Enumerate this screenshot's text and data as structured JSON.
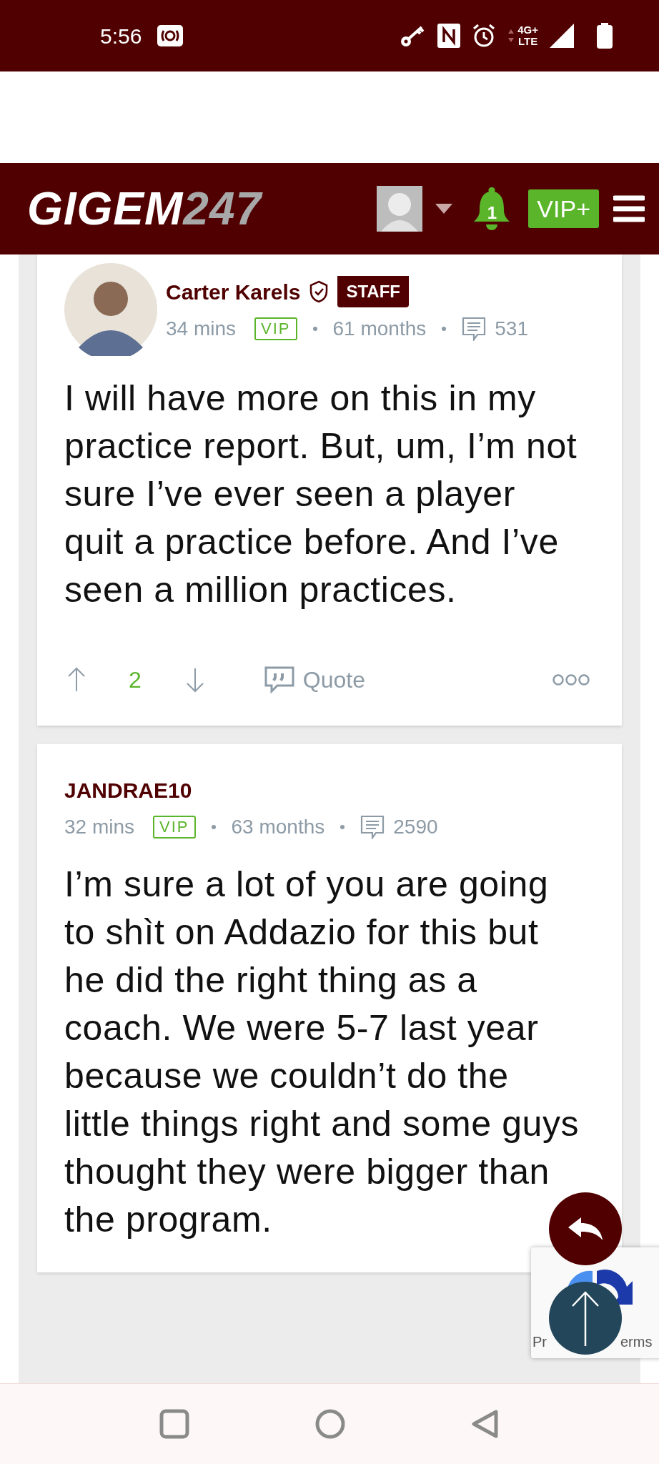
{
  "status_bar": {
    "time": "5:56",
    "network_top": "4G+",
    "network_bottom": "LTE"
  },
  "header": {
    "logo_main": "GIGEM",
    "logo_suffix": "247",
    "notification_count": "1",
    "vip_button": "VIP+"
  },
  "posts": [
    {
      "author": "Carter Karels",
      "avatar": true,
      "verified": true,
      "badge": "STAFF",
      "time": "34 mins",
      "vip": "VIP",
      "tenure": "61 months",
      "post_count": "531",
      "body": "I will have more on this in my practice report. But, um, I’m not sure I’ve ever seen a player quit a practice before. And I’ve seen a million practices.",
      "actions": {
        "votes": "2",
        "quote": "Quote"
      }
    },
    {
      "author": "JANDRAE10",
      "avatar": false,
      "verified": false,
      "time": "32 mins",
      "vip": "VIP",
      "tenure": "63 months",
      "post_count": "2590",
      "body": "I’m sure a lot of you are going to shìt on Addazio for this but he did the right thing as a coach. We were 5-7 last year because we couldn’t do the little things right and some guys thought they were bigger than the program."
    }
  ],
  "recaptcha": {
    "text_start": "Pr",
    "text_end": "erms"
  }
}
